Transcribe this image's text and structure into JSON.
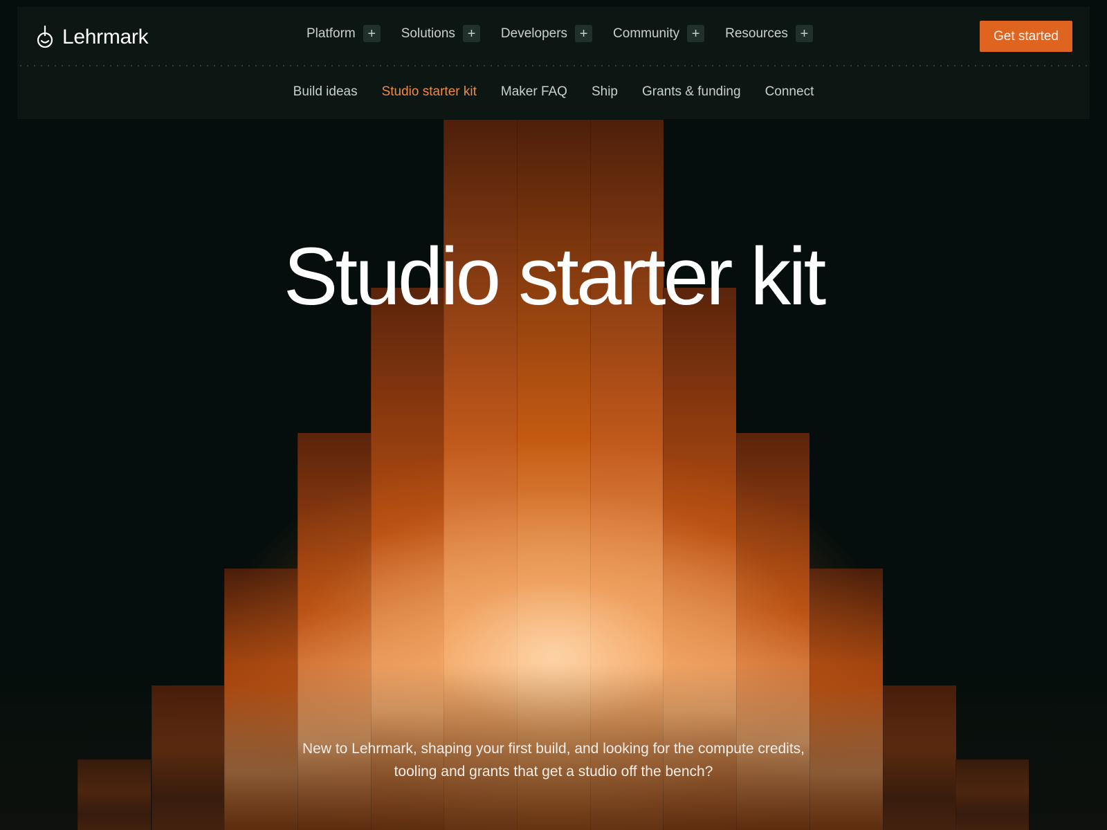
{
  "brand": {
    "name": "Lehrmark",
    "icon": "power-ring-icon"
  },
  "nav": {
    "items": [
      {
        "label": "Platform",
        "icon": "plus-icon"
      },
      {
        "label": "Solutions",
        "icon": "plus-icon"
      },
      {
        "label": "Developers",
        "icon": "plus-icon"
      },
      {
        "label": "Community",
        "icon": "plus-icon"
      },
      {
        "label": "Resources",
        "icon": "plus-icon"
      }
    ],
    "cta_label": "Get started"
  },
  "subnav": {
    "items": [
      "Build ideas",
      "Studio starter kit",
      "Maker FAQ",
      "Ship",
      "Grants & funding",
      "Connect"
    ],
    "active": "Studio starter kit"
  },
  "hero": {
    "title": "Studio starter kit",
    "subtitle_line1": "New to Lehrmark, shaping your first build, and looking for the compute credits,",
    "subtitle_line2": "tooling and grants that get a studio off the bench?"
  },
  "colors": {
    "background": "#050e0c",
    "header": "#0c1714",
    "accent": "#df6420",
    "active_link": "#ef8a45",
    "bar_dark": "#4a1e0a",
    "bar_mid": "#b54c10",
    "bar_light": "#f6b27a"
  }
}
